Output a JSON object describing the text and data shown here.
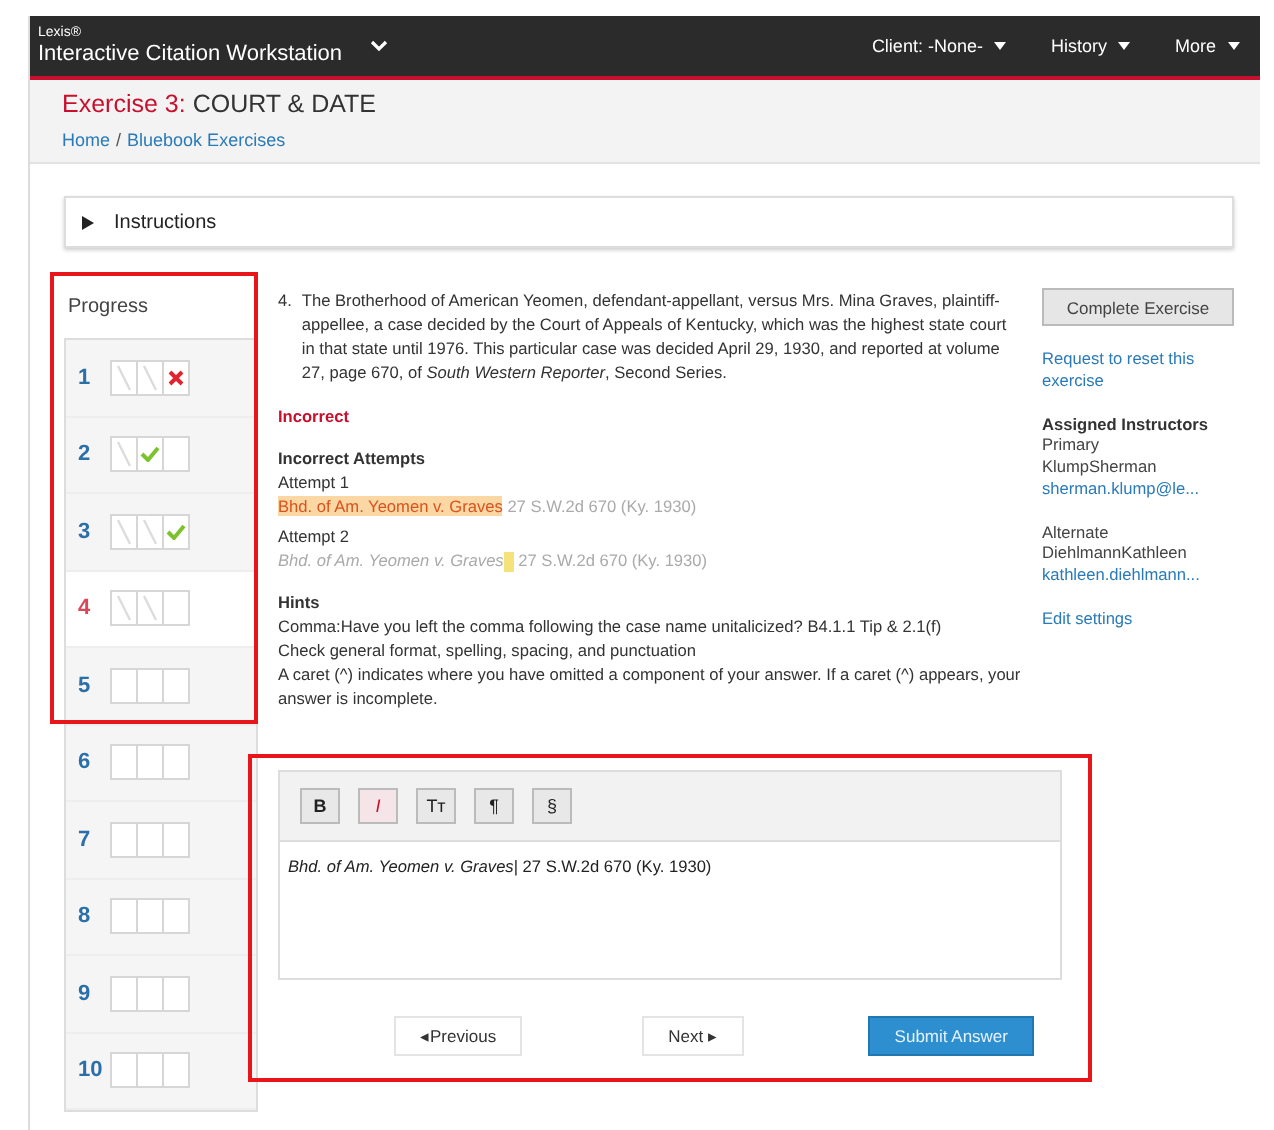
{
  "navbar": {
    "brand": "Lexis®",
    "title": "Interactive Citation Workstation",
    "menus": [
      {
        "label": "Client: -None-"
      },
      {
        "label": "History"
      },
      {
        "label": "More"
      }
    ]
  },
  "header": {
    "exercise": "Exercise 3:",
    "title": "COURT & DATE",
    "breadcrumb": [
      {
        "label": "Home"
      },
      {
        "label": "Bluebook Exercises"
      }
    ],
    "separator": "/"
  },
  "instructions": {
    "label": "Instructions",
    "expanded": false
  },
  "progress": {
    "title": "Progress",
    "items": [
      {
        "number": "1",
        "selected": false,
        "cells": [
          {
            "kind": "attempted"
          },
          {
            "kind": "attempted"
          },
          {
            "kind": "cross"
          }
        ]
      },
      {
        "number": "2",
        "selected": false,
        "cells": [
          {
            "kind": "attempted"
          },
          {
            "kind": "check"
          },
          {
            "kind": "empty"
          }
        ]
      },
      {
        "number": "3",
        "selected": false,
        "cells": [
          {
            "kind": "attempted"
          },
          {
            "kind": "attempted"
          },
          {
            "kind": "check"
          }
        ]
      },
      {
        "number": "4",
        "selected": true,
        "cells": [
          {
            "kind": "attempted"
          },
          {
            "kind": "attempted"
          },
          {
            "kind": "empty"
          }
        ]
      },
      {
        "number": "5",
        "selected": false,
        "cells": [
          {
            "kind": "empty"
          },
          {
            "kind": "empty"
          },
          {
            "kind": "empty"
          }
        ]
      },
      {
        "number": "6",
        "selected": false,
        "cells": [
          {
            "kind": "empty"
          },
          {
            "kind": "empty"
          },
          {
            "kind": "empty"
          }
        ]
      },
      {
        "number": "7",
        "selected": false,
        "cells": [
          {
            "kind": "empty"
          },
          {
            "kind": "empty"
          },
          {
            "kind": "empty"
          }
        ]
      },
      {
        "number": "8",
        "selected": false,
        "cells": [
          {
            "kind": "empty"
          },
          {
            "kind": "empty"
          },
          {
            "kind": "empty"
          }
        ]
      },
      {
        "number": "9",
        "selected": false,
        "cells": [
          {
            "kind": "empty"
          },
          {
            "kind": "empty"
          },
          {
            "kind": "empty"
          }
        ]
      },
      {
        "number": "10",
        "selected": false,
        "cells": [
          {
            "kind": "empty"
          },
          {
            "kind": "empty"
          },
          {
            "kind": "empty"
          }
        ]
      }
    ]
  },
  "question": {
    "number": "4.",
    "text": "The Brotherhood of American Yeomen, defendant-appellant, versus Mrs. Mina Graves, plaintiff-appellee, a case decided by the Court of Appeals of Kentucky, which was the highest state court in that state until 1976. This particular case was decided April 29, 1930, and reported at volume 27, page 670, of *South Western Reporter*, Second Series."
  },
  "result": "Incorrect",
  "attempts": {
    "title": "Incorrect Attempts",
    "items": [
      {
        "label": "Attempt 1",
        "parts": [
          {
            "kind": "error",
            "text": "Bhd. of Am. Yeomen v. Graves"
          },
          {
            "kind": "faded",
            "text": " 27 S.W.2d 670 (Ky. 1930)"
          }
        ]
      },
      {
        "label": "Attempt 2",
        "parts": [
          {
            "kind": "faded-italic",
            "text": "Bhd. of Am. Yeomen v. Graves"
          },
          {
            "kind": "caret"
          },
          {
            "kind": "faded",
            "text": " 27 S.W.2d 670 (Ky. 1930)"
          }
        ]
      }
    ]
  },
  "hints": {
    "title": "Hints",
    "lines": [
      "Comma:Have you left the comma following the case name unitalicized? B4.1.1 Tip & 2.1(f)",
      "Check general format, spelling, spacing, and punctuation",
      "A caret (^) indicates where you have omitted a component of your answer. If a caret (^) appears, your answer is incomplete."
    ]
  },
  "editor": {
    "tools": [
      {
        "label": "B",
        "kind": "bold",
        "selected": false
      },
      {
        "label": "I",
        "kind": "italic",
        "selected": true
      },
      {
        "label": "Tт",
        "kind": "case",
        "selected": false
      },
      {
        "label": "¶",
        "kind": "para",
        "selected": false
      },
      {
        "label": "§",
        "kind": "section",
        "selected": false
      }
    ],
    "value": "*Bhd. of Am. Yeomen v. Graves*| 27 S.W.2d 670 (Ky. 1930)"
  },
  "buttons": {
    "previous": "◂Previous",
    "next": "Next ▸",
    "submit": "Submit Answer"
  },
  "side": {
    "complete": "Complete Exercise",
    "reset": "Request to reset this exercise",
    "instructors_title": "Assigned Instructors",
    "instructors": [
      {
        "role": "Primary",
        "name": "KlumpSherman",
        "email": "sherman.klump@le..."
      },
      {
        "role": "Alternate",
        "name": "DiehlmannKathleen",
        "email": "kathleen.diehlmann..."
      }
    ],
    "edit": "Edit settings"
  }
}
